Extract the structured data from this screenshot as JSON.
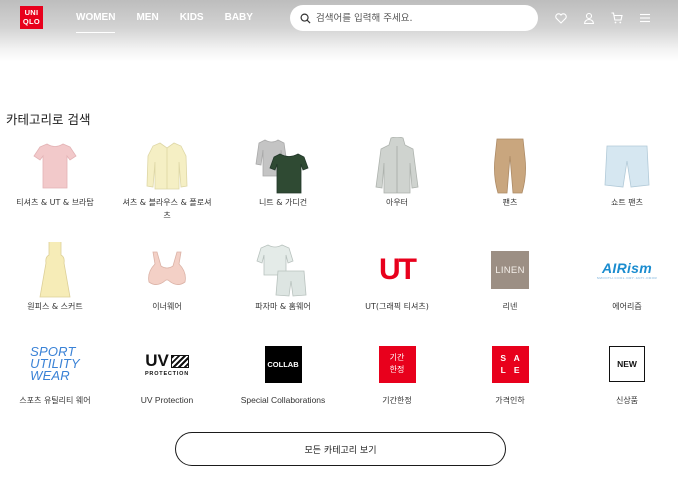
{
  "brand": {
    "logo_lines": [
      "UNI",
      "QLO"
    ],
    "color": "#e8001c"
  },
  "nav": [
    {
      "label": "WOMEN",
      "active": true
    },
    {
      "label": "MEN",
      "active": false
    },
    {
      "label": "KIDS",
      "active": false
    },
    {
      "label": "BABY",
      "active": false
    }
  ],
  "search": {
    "placeholder": "검색어를 입력해 주세요."
  },
  "header_icons": [
    "heart-icon",
    "user-icon",
    "cart-icon",
    "menu-icon"
  ],
  "section_title": "카테고리로 검색",
  "categories": [
    {
      "label": "티셔츠 & UT & 브라탑"
    },
    {
      "label": "셔츠 & 블라우스 & 폴로셔츠"
    },
    {
      "label": "니트 & 가디건"
    },
    {
      "label": "아우터"
    },
    {
      "label": "팬츠"
    },
    {
      "label": "쇼트 팬츠"
    },
    {
      "label": "원피스 & 스커트"
    },
    {
      "label": "이너웨어"
    },
    {
      "label": "파자마 & 홈웨어"
    },
    {
      "label": "UT(그래픽 티셔츠)",
      "logo": "UT"
    },
    {
      "label": "리넨",
      "logo": "LINEN"
    },
    {
      "label": "에어리즘",
      "logo": "AIRism",
      "logo_sub": "SMOOTH·COOL·DRY·ANTI-ODOR"
    },
    {
      "label": "스포츠 유틸리티 웨어",
      "logo_lines": [
        "SPORT",
        "UTILITY",
        "WEAR"
      ]
    },
    {
      "label": "UV Protection",
      "logo": "UV",
      "logo_sub": "PROTECTION"
    },
    {
      "label": "Special Collaborations",
      "logo": "COLLAB"
    },
    {
      "label": "기간한정",
      "logo_lines": [
        "기간",
        "한정"
      ]
    },
    {
      "label": "가격인하",
      "logo_lines": [
        "S",
        "A",
        "L",
        "E"
      ]
    },
    {
      "label": "신상품",
      "logo": "NEW"
    }
  ],
  "all_button_label": "모든 카테고리 보기"
}
